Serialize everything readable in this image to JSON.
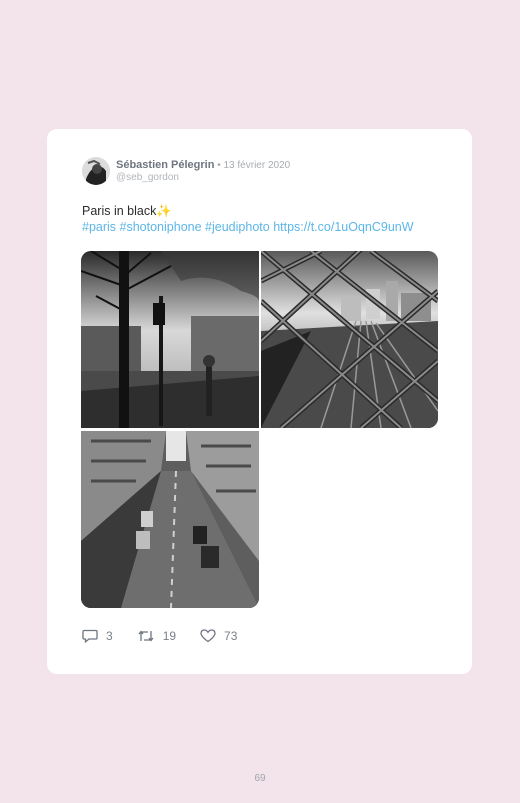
{
  "tweet": {
    "author_name": "Sébastien Pélegrin",
    "separator": " • ",
    "date": "13 février 2020",
    "handle": "@seb_gordon",
    "text": "Paris in black",
    "emoji": "✨",
    "hashtags": [
      "#paris",
      "#shotoniphone",
      "#jeudiphoto"
    ],
    "link": "https://t.co/1uOqnC9unW",
    "photos": [
      {
        "icon": "street-tree-traffic-light-photo"
      },
      {
        "icon": "chain-link-fence-railway-photo"
      },
      {
        "icon": "narrow-street-cars-photo"
      }
    ],
    "replies": "3",
    "retweets": "19",
    "likes": "73"
  },
  "footer": {
    "page_number": "69"
  }
}
